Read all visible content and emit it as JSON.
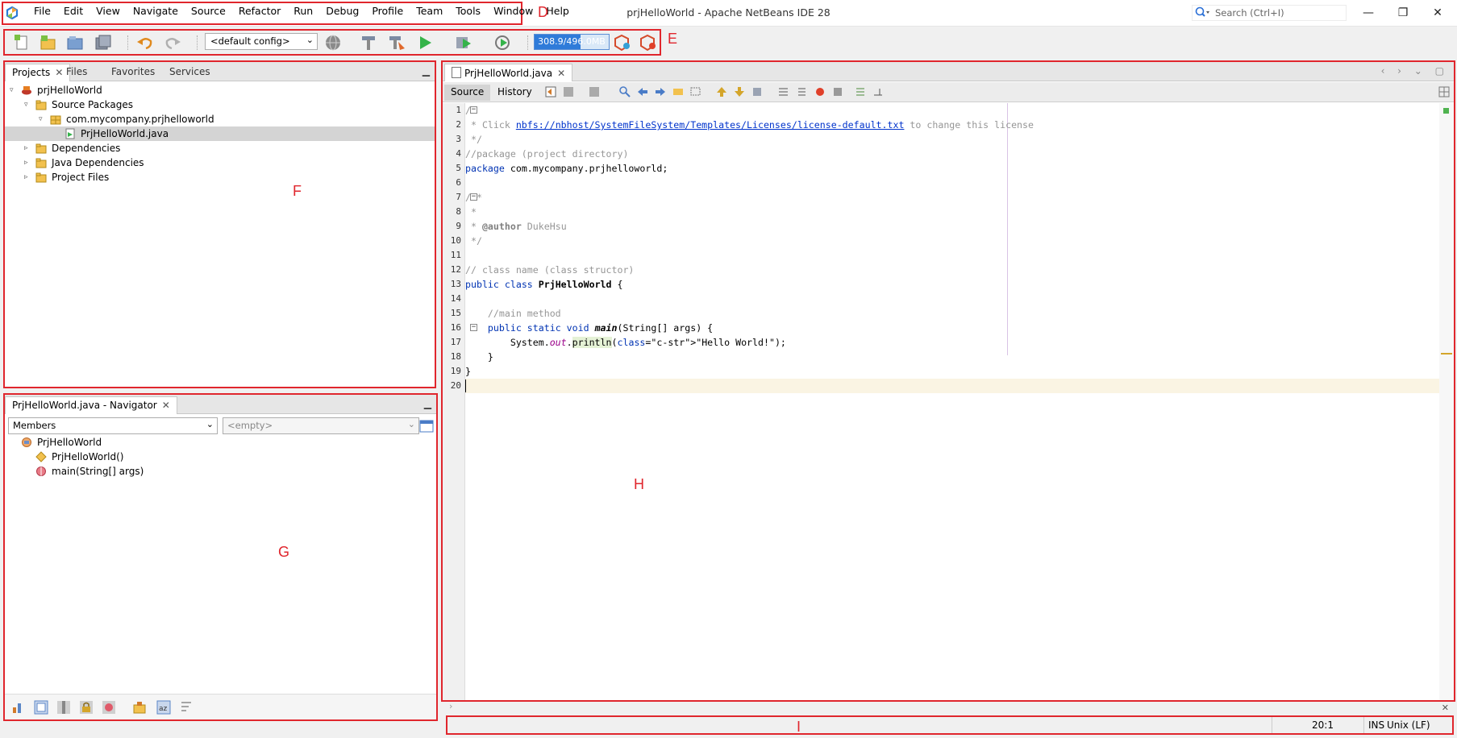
{
  "window": {
    "title": "prjHelloWorld - Apache NetBeans IDE 28",
    "search_placeholder": "Search (Ctrl+I)",
    "controls": {
      "minimize": "—",
      "restore": "❐",
      "close": "✕"
    }
  },
  "menu": [
    "File",
    "Edit",
    "View",
    "Navigate",
    "Source",
    "Refactor",
    "Run",
    "Debug",
    "Profile",
    "Team",
    "Tools",
    "Window",
    "Help"
  ],
  "annotations": {
    "menu": "D",
    "toolbar": "E",
    "projects": "F",
    "navigator": "G",
    "editor": "H",
    "status": "I"
  },
  "toolbar": {
    "config": "<default config>",
    "memory_label": "308.9/496.0MB",
    "memory_used_fraction": 0.62
  },
  "projects_panel": {
    "tabs": [
      "Projects",
      "Files",
      "Favorites",
      "Services"
    ],
    "active_tab": "Projects",
    "tree": [
      {
        "label": "prjHelloWorld",
        "depth": 0,
        "expanded": true,
        "icon": "project-icon"
      },
      {
        "label": "Source Packages",
        "depth": 1,
        "expanded": true,
        "icon": "folder-icon"
      },
      {
        "label": "com.mycompany.prjhelloworld",
        "depth": 2,
        "expanded": true,
        "icon": "package-icon"
      },
      {
        "label": "PrjHelloWorld.java",
        "depth": 3,
        "expanded": null,
        "icon": "java-file-icon",
        "selected": true
      },
      {
        "label": "Dependencies",
        "depth": 1,
        "expanded": false,
        "icon": "folder-icon"
      },
      {
        "label": "Java Dependencies",
        "depth": 1,
        "expanded": false,
        "icon": "folder-icon"
      },
      {
        "label": "Project Files",
        "depth": 1,
        "expanded": false,
        "icon": "folder-icon"
      }
    ]
  },
  "navigator_panel": {
    "tab": "PrjHelloWorld.java - Navigator",
    "members_combo": "Members",
    "empty_combo": "<empty>",
    "tree": [
      {
        "label": "PrjHelloWorld",
        "depth": 0,
        "icon": "class-icon"
      },
      {
        "label": "PrjHelloWorld()",
        "depth": 1,
        "icon": "constructor-icon"
      },
      {
        "label": "main(String[] args)",
        "depth": 1,
        "icon": "method-icon"
      }
    ]
  },
  "editor": {
    "tab": "PrjHelloWorld.java",
    "subtabs": [
      "Source",
      "History"
    ],
    "active_subtab": "Source",
    "lines": [
      "/*",
      " * Click nbfs://nbhost/SystemFileSystem/Templates/Licenses/license-default.txt to change this license",
      " */",
      "//package (project directory)",
      "package com.mycompany.prjhelloworld;",
      "",
      "/**",
      " *",
      " * @author DukeHsu",
      " */",
      "",
      "// class name (class structor)",
      "public class PrjHelloWorld {",
      "",
      "    //main method",
      "    public static void main(String[] args) {",
      "        System.out.println(\"Hello World!\");",
      "    }",
      "}",
      ""
    ],
    "current_line": 20
  },
  "status": {
    "position": "20:1",
    "mode": "INS",
    "line_endings": "Unix (LF)"
  }
}
